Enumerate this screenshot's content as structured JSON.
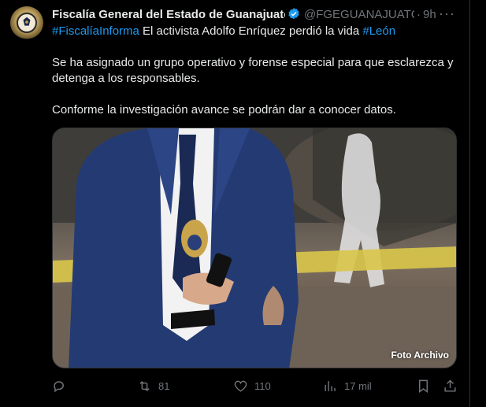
{
  "tweet": {
    "author_name": "Fiscalía General del Estado de Guanajuato",
    "handle": "@FGEGUANAJUATC",
    "separator": "·",
    "time": "9h",
    "more": "···",
    "text": {
      "tag1": "#FiscalíaInforma",
      "line1_rest": " El activista Adolfo Enríquez perdió la vida ",
      "tag2": "#León",
      "para2": "Se ha asignado un grupo operativo y forense especial para que esclarezca y detenga a los responsables.",
      "para3": "Conforme la investigación avance se podrán dar a conocer datos."
    },
    "media": {
      "caption": "Foto Archivo"
    },
    "stats": {
      "replies": "",
      "retweets": "81",
      "likes": "110",
      "views": "17 mil"
    }
  },
  "colors": {
    "accent": "#1d9bf0",
    "muted": "#71767b",
    "text": "#e7e9ea",
    "background": "#000000"
  },
  "icons": [
    "seal-icon",
    "verified-badge-icon",
    "more-icon",
    "reply-icon",
    "retweet-icon",
    "like-icon",
    "views-icon",
    "bookmark-icon",
    "share-icon"
  ]
}
